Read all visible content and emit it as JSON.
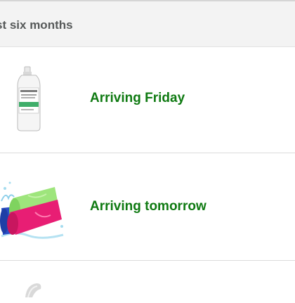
{
  "section": {
    "title": "st six months"
  },
  "orders": [
    {
      "status": "Arriving Friday",
      "image": "bottle-product-image"
    },
    {
      "status": "Arriving tomorrow",
      "image": "cooling-towels-product-image"
    },
    {
      "status": "",
      "image": "partial-product-image"
    }
  ],
  "colors": {
    "status_green": "#0f7a12",
    "header_bg": "#f3f3f3",
    "header_text": "#565959",
    "divider": "#dcdcdc"
  }
}
